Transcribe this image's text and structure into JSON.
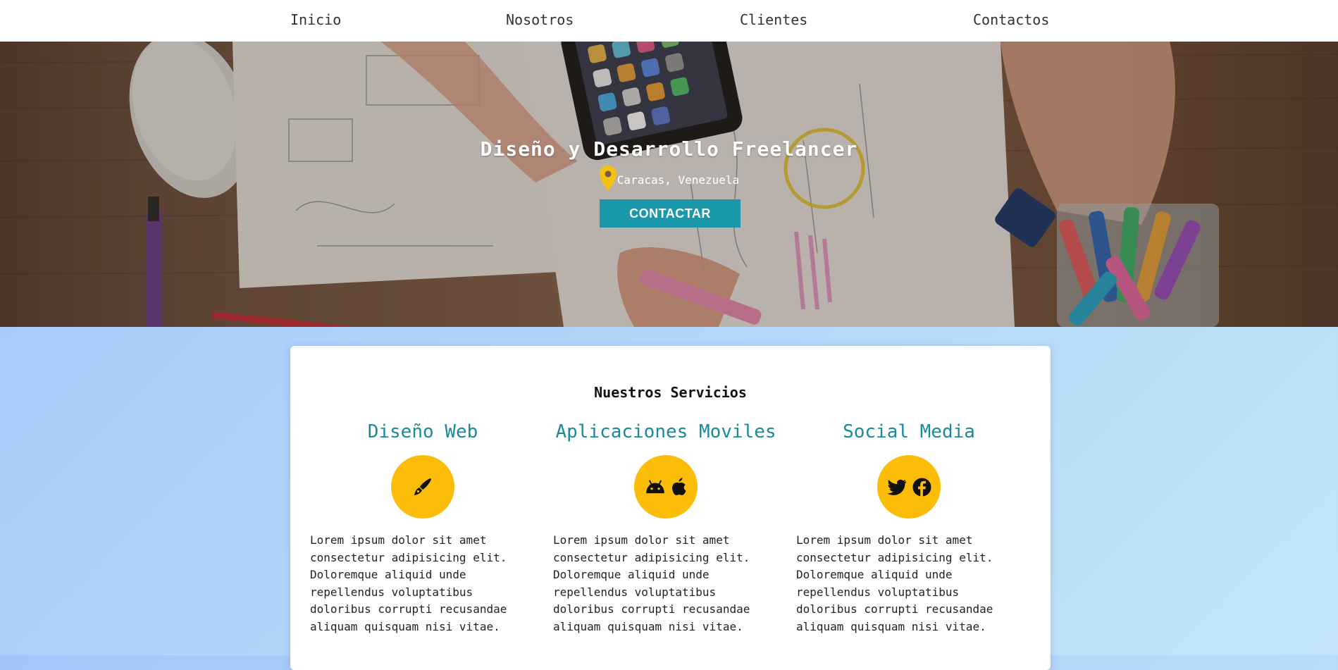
{
  "nav": {
    "items": [
      {
        "label": "Inicio"
      },
      {
        "label": "Nosotros"
      },
      {
        "label": "Clientes"
      },
      {
        "label": "Contactos"
      }
    ]
  },
  "hero": {
    "title": "Diseño y Desarrollo Freelancer",
    "location": "Caracas, Venezuela",
    "location_icon": "map-pin-icon",
    "cta_label": "CONTACTAR"
  },
  "services": {
    "title": "Nuestros Servicios",
    "items": [
      {
        "name": "Diseño Web",
        "icons": [
          "pen-nib-icon"
        ],
        "text": "Lorem ipsum dolor sit amet consectetur adipisicing elit. Doloremque aliquid unde repellendus voluptatibus doloribus corrupti recusandae aliquam quisquam nisi vitae."
      },
      {
        "name": "Aplicaciones Moviles",
        "icons": [
          "android-icon",
          "apple-icon"
        ],
        "text": "Lorem ipsum dolor sit amet consectetur adipisicing elit. Doloremque aliquid unde repellendus voluptatibus doloribus corrupti recusandae aliquam quisquam nisi vitae."
      },
      {
        "name": "Social Media",
        "icons": [
          "twitter-icon",
          "facebook-icon"
        ],
        "text": "Lorem ipsum dolor sit amet consectetur adipisicing elit. Doloremque aliquid unde repellendus voluptatibus doloribus corrupti recusandae aliquam quisquam nisi vitae."
      }
    ]
  },
  "colors": {
    "accent_teal": "#1898a8",
    "service_title": "#1a8a9a",
    "icon_circle": "#fbbd08",
    "pin": "#f5c10e"
  }
}
